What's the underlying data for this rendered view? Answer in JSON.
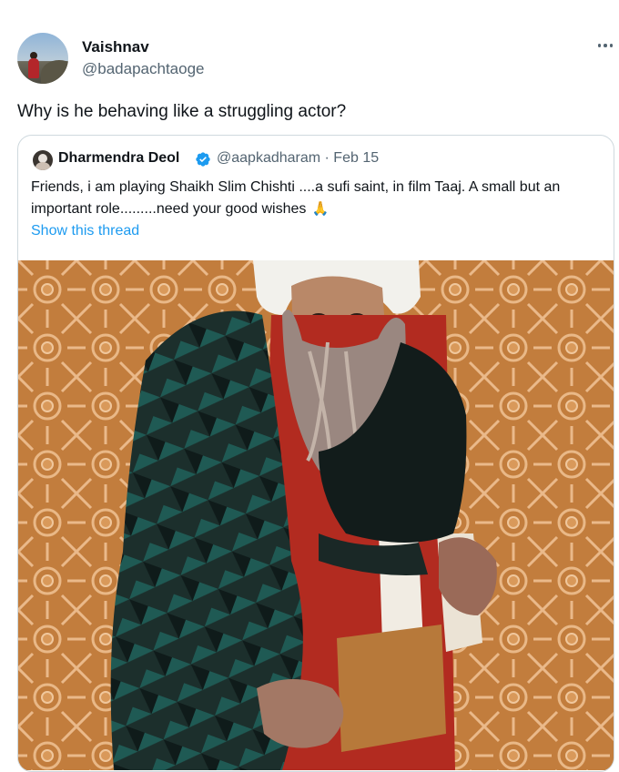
{
  "tweet": {
    "author_name": "Vaishnav",
    "author_handle": "@badapachtaoge",
    "text": "Why is he behaving like a struggling actor?"
  },
  "quoted_tweet": {
    "author_name": "Dharmendra Deol",
    "handle_date": "@aapkadharam · Feb 15",
    "text": "Friends, i am playing Shaikh Slim Chishti ....a sufi saint, in film Taaj. A small but an important role.........need your good wishes",
    "show_thread": "Show this thread"
  },
  "icons": {
    "more": "more-options-icon",
    "verified": "verified-badge-icon",
    "pray": "folded-hands-emoji"
  },
  "colors": {
    "link": "#1d9bf0",
    "secondary_text": "#536471",
    "verified": "#1d9bf0",
    "border": "#cfd9de"
  }
}
